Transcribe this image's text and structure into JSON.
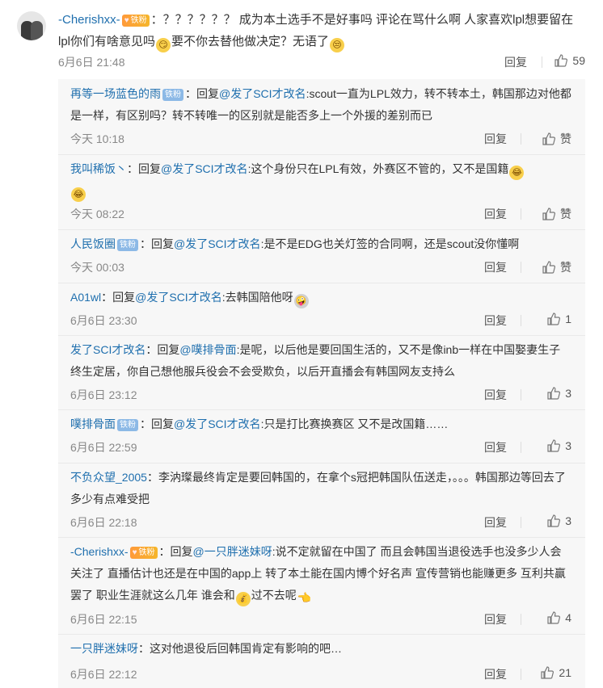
{
  "main_comment": {
    "username": "-Cherishxx-",
    "badge": "铁粉",
    "text_part1": "：？？？？？？ 成为本土选手不是好事吗 评论在骂什么啊 人家喜欢lpl想要留在lpl你们有啥意见吗",
    "text_part2": "要不你去替他做决定？无语了",
    "time": "6月6日 21:48",
    "reply_label": "回复",
    "likes": "59"
  },
  "replies": [
    {
      "user": "再等一场蓝色的雨",
      "badge": "铁粉",
      "pre": "：回复",
      "mention": "@发了SCI才改名",
      "text": ":scout一直为LPL效力，转不转本土，韩国那边对他都是一样，有区别吗？转不转唯一的区别就是能否多上一个外援的差别而已",
      "time": "今天 10:18",
      "reply": "回复",
      "likes": "赞"
    },
    {
      "user": "我叫稀饭丶",
      "badge": "",
      "pre": "：回复",
      "mention": "@发了SCI才改名",
      "text": ":这个身份只在LPL有效，外赛区不管的，又不是国籍",
      "time": "今天 08:22",
      "reply": "回复",
      "likes": "赞"
    },
    {
      "user": "人民饭圈",
      "badge": "铁粉",
      "pre": "：回复",
      "mention": "@发了SCI才改名",
      "text": ":是不是EDG也关灯签的合同啊，还是scout没你懂啊",
      "time": "今天 00:03",
      "reply": "回复",
      "likes": "赞"
    },
    {
      "user": "A01wl",
      "badge": "",
      "pre": "：回复",
      "mention": "@发了SCI才改名",
      "text": ":去韩国陪他呀",
      "time": "6月6日 23:30",
      "reply": "回复",
      "likes": "1"
    },
    {
      "user": "发了SCI才改名",
      "badge": "",
      "pre": "：回复",
      "mention": "@噗排骨面",
      "text": ":是呢，以后他是要回国生活的，又不是像inb一样在中国娶妻生子终生定居，你自己想他服兵役会不会受欺负，以后开直播会有韩国网友支持么",
      "time": "6月6日 23:12",
      "reply": "回复",
      "likes": "3"
    },
    {
      "user": "噗排骨面",
      "badge": "铁粉",
      "pre": "：回复",
      "mention": "@发了SCI才改名",
      "text": ":只是打比赛换赛区 又不是改国籍……",
      "time": "6月6日 22:59",
      "reply": "回复",
      "likes": "3"
    },
    {
      "user": "不负众望_2005",
      "badge": "",
      "pre": "：",
      "mention": "",
      "text": "李汭璨最终肯定是要回韩国的，在拿个s冠把韩国队伍送走，。。。韩国那边等回去了多少有点难受把",
      "time": "6月6日 22:18",
      "reply": "回复",
      "likes": "3"
    },
    {
      "user": "-Cherishxx-",
      "badge": "铁粉",
      "pre": "：回复",
      "mention": "@一只胖迷妹呀",
      "text": ":说不定就留在中国了 而且会韩国当退役选手也没多少人会关注了 直播估计也还是在中国的app上 转了本土能在国内博个好名声 宣传营销也能赚更多 互利共赢罢了 职业生涯就这么几年 谁会和",
      "text2": "过不去呢",
      "time": "6月6日 22:15",
      "reply": "回复",
      "likes": "4"
    },
    {
      "user": "一只胖迷妹呀",
      "badge": "",
      "pre": "：",
      "mention": "",
      "text": "这对他退役后回韩国肯定有影响的吧…",
      "time": "6月6日 22:12",
      "reply": "回复",
      "likes": "21"
    }
  ]
}
